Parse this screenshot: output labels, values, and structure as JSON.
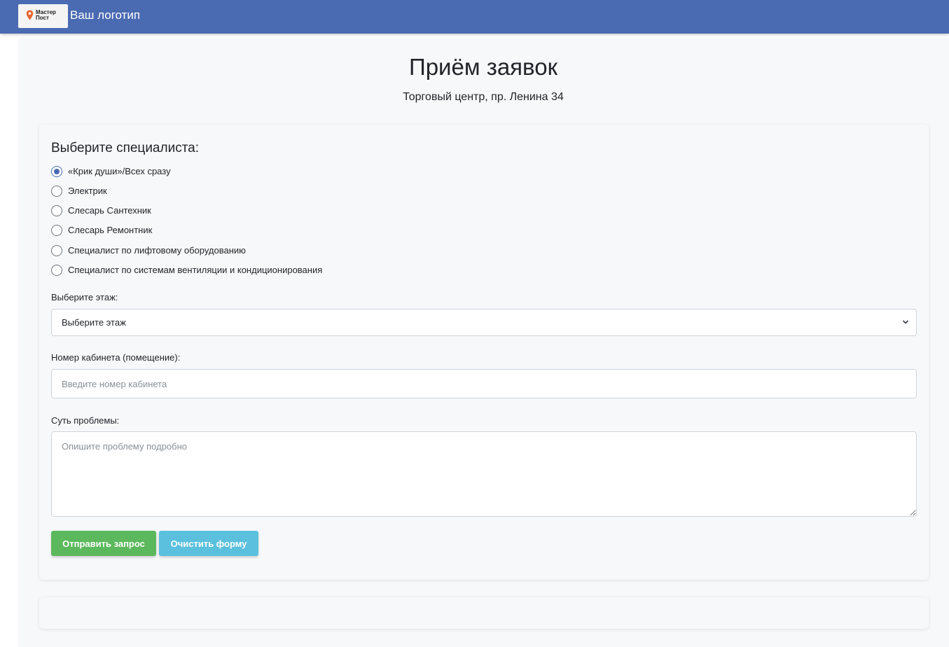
{
  "header": {
    "logo_text_line1": "Мастер",
    "logo_text_line2": "Пост",
    "brand": "Ваш логотип",
    "brand_color": "#4a6ab2",
    "logo_icon": "location-pin-icon",
    "logo_icon_color": "#e8632b"
  },
  "main": {
    "title": "Приём заявок",
    "subtitle": "Торговый центр, пр. Ленина 34"
  },
  "form": {
    "specialist_heading": "Выберите специалиста:",
    "specialists": [
      {
        "label": "«Крик души»/Всех сразу",
        "checked": true
      },
      {
        "label": "Электрик",
        "checked": false
      },
      {
        "label": "Слесарь Сантехник",
        "checked": false
      },
      {
        "label": "Слесарь Ремонтник",
        "checked": false
      },
      {
        "label": "Специалист по лифтовому оборудованию",
        "checked": false
      },
      {
        "label": "Специалист по системам вентиляции и кондиционирования",
        "checked": false
      }
    ],
    "floor_label": "Выберите этаж:",
    "floor_selected": "Выберите этаж",
    "room_label": "Номер кабинета (помещение):",
    "room_placeholder": "Введите номер кабинета",
    "problem_label": "Суть проблемы:",
    "problem_placeholder": "Опишите проблему подробно",
    "submit_label": "Отправить запрос",
    "clear_label": "Очистить форму",
    "submit_color": "#5cb85c",
    "clear_color": "#5bc0de"
  }
}
